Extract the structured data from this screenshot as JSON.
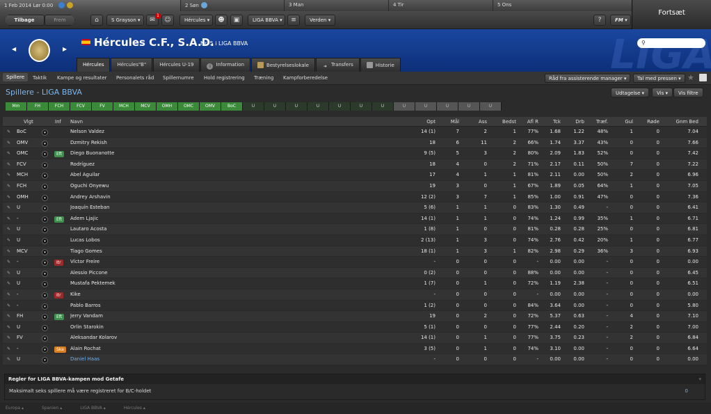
{
  "calendar": {
    "d1": "1 Feb 2014 Lør 0:00",
    "d2": "2 Søn",
    "d3": "3 Man",
    "d4": "4 Tir",
    "d5": "5 Ons"
  },
  "continue_label": "Fortsæt",
  "toolbar": {
    "back": "Tilbage",
    "forward": "Frem",
    "manager": "S Grayson",
    "inbox_badge": "1",
    "club": "Hércules",
    "league": "LIGA BBVA",
    "world": "Verden",
    "fm": "FM"
  },
  "header": {
    "club_name": "Hércules C.F., S.A.D.",
    "position": "Nr. 5 i LIGA BBVA",
    "liga_watermark": "LIGA"
  },
  "tabs": [
    "Hércules",
    "Hércules\"B\"",
    "Hércules U-19",
    "Information",
    "Bestyrelseslokale",
    "Transfers",
    "Historie"
  ],
  "subnav": [
    "Spillere",
    "Taktik",
    "Kampe og resultater",
    "Personalets råd",
    "Spillernumre",
    "Hold registrering",
    "Træning",
    "Kampforberedelse"
  ],
  "subnav_buttons": {
    "advice": "Råd fra assisterende manager",
    "press": "Tal med pressen"
  },
  "page": {
    "title": "Spillere - LIGA BBVA",
    "selection": "Udtagelse",
    "view": "Vis",
    "filter": "Vis filtre"
  },
  "lineup": [
    {
      "l": "Mm",
      "t": "g"
    },
    {
      "l": "FH",
      "t": "g"
    },
    {
      "l": "FCH",
      "t": "g"
    },
    {
      "l": "FCV",
      "t": "g"
    },
    {
      "l": "FV",
      "t": "g"
    },
    {
      "l": "MCH",
      "t": "g"
    },
    {
      "l": "MCV",
      "t": "g"
    },
    {
      "l": "OMH",
      "t": "g"
    },
    {
      "l": "OMC",
      "t": "g"
    },
    {
      "l": "OMV",
      "t": "g"
    },
    {
      "l": "BoC",
      "t": "g"
    },
    {
      "l": "U",
      "t": "d"
    },
    {
      "l": "U",
      "t": "d"
    },
    {
      "l": "U",
      "t": "d"
    },
    {
      "l": "U",
      "t": "d"
    },
    {
      "l": "U",
      "t": "d"
    },
    {
      "l": "U",
      "t": "d"
    },
    {
      "l": "U",
      "t": "d"
    },
    {
      "l": "U",
      "t": "e"
    },
    {
      "l": "U",
      "t": "e"
    },
    {
      "l": "U",
      "t": "e"
    },
    {
      "l": "U",
      "t": "e"
    },
    {
      "l": "U",
      "t": "e"
    }
  ],
  "columns": {
    "vlgt": "Vlgt",
    "inf": "Inf",
    "navn": "Navn",
    "opt": "Opt",
    "maal": "Mål",
    "ass": "Ass",
    "bedst": "Bedst",
    "aflr": "Afl R",
    "tck": "Tck",
    "drb": "Drb",
    "traef": "Træf.",
    "gul": "Gul",
    "roede": "Røde",
    "gnm": "Gnm Bed"
  },
  "players": [
    {
      "vlgt": "BoC",
      "inf": "",
      "navn": "Nelson Valdez",
      "opt": "14 (1)",
      "maal": "7",
      "ass": "2",
      "bedst": "1",
      "aflr": "77%",
      "tck": "1.68",
      "drb": "1.22",
      "traef": "48%",
      "gul": "1",
      "roede": "0",
      "gnm": "7.04"
    },
    {
      "vlgt": "OMV",
      "inf": "",
      "navn": "Dzmitry Rekish",
      "opt": "18",
      "maal": "6",
      "ass": "11",
      "bedst": "2",
      "aflr": "66%",
      "tck": "1.74",
      "drb": "3.37",
      "traef": "43%",
      "gul": "0",
      "roede": "0",
      "gnm": "7.66"
    },
    {
      "vlgt": "OMC",
      "inf": "Eft",
      "navn": "Diego Buonanotte",
      "opt": "9 (5)",
      "maal": "5",
      "ass": "3",
      "bedst": "2",
      "aflr": "80%",
      "tck": "2.09",
      "drb": "1.83",
      "traef": "52%",
      "gul": "0",
      "roede": "0",
      "gnm": "7.42"
    },
    {
      "vlgt": "FCV",
      "inf": "",
      "navn": "Rodríguez",
      "opt": "18",
      "maal": "4",
      "ass": "0",
      "bedst": "2",
      "aflr": "71%",
      "tck": "2.17",
      "drb": "0.11",
      "traef": "50%",
      "gul": "7",
      "roede": "0",
      "gnm": "7.22"
    },
    {
      "vlgt": "MCH",
      "inf": "",
      "navn": "Abel Aguilar",
      "opt": "17",
      "maal": "4",
      "ass": "1",
      "bedst": "1",
      "aflr": "81%",
      "tck": "2.11",
      "drb": "0.00",
      "traef": "50%",
      "gul": "2",
      "roede": "0",
      "gnm": "6.96"
    },
    {
      "vlgt": "FCH",
      "inf": "",
      "navn": "Oguchi Onyewu",
      "opt": "19",
      "maal": "3",
      "ass": "0",
      "bedst": "1",
      "aflr": "67%",
      "tck": "1.89",
      "drb": "0.05",
      "traef": "64%",
      "gul": "1",
      "roede": "0",
      "gnm": "7.05"
    },
    {
      "vlgt": "OMH",
      "inf": "",
      "navn": "Andrey Arshavin",
      "opt": "12 (2)",
      "maal": "3",
      "ass": "7",
      "bedst": "1",
      "aflr": "85%",
      "tck": "1.00",
      "drb": "0.91",
      "traef": "47%",
      "gul": "0",
      "roede": "0",
      "gnm": "7.36"
    },
    {
      "vlgt": "U",
      "inf": "",
      "navn": "Joaquín Esteban",
      "opt": "5 (6)",
      "maal": "1",
      "ass": "1",
      "bedst": "0",
      "aflr": "83%",
      "tck": "1.30",
      "drb": "0.49",
      "traef": "-",
      "gul": "0",
      "roede": "0",
      "gnm": "6.41"
    },
    {
      "vlgt": "-",
      "inf": "Eft",
      "navn": "Adem Ljajic",
      "opt": "14 (1)",
      "maal": "1",
      "ass": "1",
      "bedst": "0",
      "aflr": "74%",
      "tck": "1.24",
      "drb": "0.99",
      "traef": "35%",
      "gul": "1",
      "roede": "0",
      "gnm": "6.71"
    },
    {
      "vlgt": "U",
      "inf": "",
      "navn": "Lautaro Acosta",
      "opt": "1 (8)",
      "maal": "1",
      "ass": "0",
      "bedst": "0",
      "aflr": "81%",
      "tck": "0.28",
      "drb": "0.28",
      "traef": "25%",
      "gul": "0",
      "roede": "0",
      "gnm": "6.81"
    },
    {
      "vlgt": "U",
      "inf": "",
      "navn": "Lucas Lobos",
      "opt": "2 (13)",
      "maal": "1",
      "ass": "3",
      "bedst": "0",
      "aflr": "74%",
      "tck": "2.76",
      "drb": "0.42",
      "traef": "20%",
      "gul": "1",
      "roede": "0",
      "gnm": "6.77"
    },
    {
      "vlgt": "MCV",
      "inf": "",
      "navn": "Tiago Gomes",
      "opt": "18 (1)",
      "maal": "1",
      "ass": "3",
      "bedst": "1",
      "aflr": "82%",
      "tck": "2.98",
      "drb": "0.29",
      "traef": "36%",
      "gul": "3",
      "roede": "0",
      "gnm": "6.93"
    },
    {
      "vlgt": "-",
      "inf": "Itr",
      "navn": "Víctor Freire",
      "opt": "-",
      "maal": "0",
      "ass": "0",
      "bedst": "0",
      "aflr": "-",
      "tck": "0.00",
      "drb": "0.00",
      "traef": "-",
      "gul": "0",
      "roede": "0",
      "gnm": "0.00"
    },
    {
      "vlgt": "U",
      "inf": "",
      "navn": "Alessio Piccone",
      "opt": "0 (2)",
      "maal": "0",
      "ass": "0",
      "bedst": "0",
      "aflr": "88%",
      "tck": "0.00",
      "drb": "0.00",
      "traef": "-",
      "gul": "0",
      "roede": "0",
      "gnm": "6.45"
    },
    {
      "vlgt": "U",
      "inf": "",
      "navn": "Mustafa Pektemek",
      "opt": "1 (7)",
      "maal": "0",
      "ass": "1",
      "bedst": "0",
      "aflr": "72%",
      "tck": "1.19",
      "drb": "2.38",
      "traef": "-",
      "gul": "0",
      "roede": "0",
      "gnm": "6.51"
    },
    {
      "vlgt": "-",
      "inf": "Itr",
      "navn": "Kike",
      "opt": "-",
      "maal": "0",
      "ass": "0",
      "bedst": "0",
      "aflr": "-",
      "tck": "0.00",
      "drb": "0.00",
      "traef": "-",
      "gul": "0",
      "roede": "0",
      "gnm": "0.00"
    },
    {
      "vlgt": "-",
      "inf": "",
      "navn": "Pablo Barros",
      "opt": "1 (2)",
      "maal": "0",
      "ass": "0",
      "bedst": "0",
      "aflr": "84%",
      "tck": "3.64",
      "drb": "0.00",
      "traef": "-",
      "gul": "0",
      "roede": "0",
      "gnm": "5.80"
    },
    {
      "vlgt": "FH",
      "inf": "Eft",
      "navn": "Jerry Vandam",
      "opt": "19",
      "maal": "0",
      "ass": "2",
      "bedst": "0",
      "aflr": "72%",
      "tck": "5.37",
      "drb": "0.63",
      "traef": "-",
      "gul": "4",
      "roede": "0",
      "gnm": "7.10"
    },
    {
      "vlgt": "U",
      "inf": "",
      "navn": "Orlin Starokin",
      "opt": "5 (1)",
      "maal": "0",
      "ass": "0",
      "bedst": "0",
      "aflr": "77%",
      "tck": "2.44",
      "drb": "0.20",
      "traef": "-",
      "gul": "2",
      "roede": "0",
      "gnm": "7.00"
    },
    {
      "vlgt": "FV",
      "inf": "",
      "navn": "Aleksandar Kolarov",
      "opt": "14 (1)",
      "maal": "0",
      "ass": "1",
      "bedst": "0",
      "aflr": "77%",
      "tck": "3.75",
      "drb": "0.23",
      "traef": "-",
      "gul": "2",
      "roede": "0",
      "gnm": "6.84"
    },
    {
      "vlgt": "-",
      "inf": "Ska",
      "navn": "Alain Rochat",
      "opt": "3 (5)",
      "maal": "0",
      "ass": "1",
      "bedst": "0",
      "aflr": "74%",
      "tck": "3.10",
      "drb": "0.00",
      "traef": "-",
      "gul": "0",
      "roede": "0",
      "gnm": "6.64"
    },
    {
      "vlgt": "U",
      "inf": "",
      "navn": "Daniel Haas",
      "opt": "-",
      "maal": "0",
      "ass": "0",
      "bedst": "0",
      "aflr": "-",
      "tck": "0.00",
      "drb": "0.00",
      "traef": "-",
      "gul": "0",
      "roede": "0",
      "gnm": "0.00",
      "link": true
    }
  ],
  "rules": {
    "title": "Regler for LIGA BBVA-kampen mod Getafe",
    "text": "Maksimalt seks spillere må være registreret for B/C-holdet",
    "value": "0"
  },
  "footer": [
    "Europa",
    "Spanien",
    "LIGA BBVA",
    "Hércules"
  ]
}
